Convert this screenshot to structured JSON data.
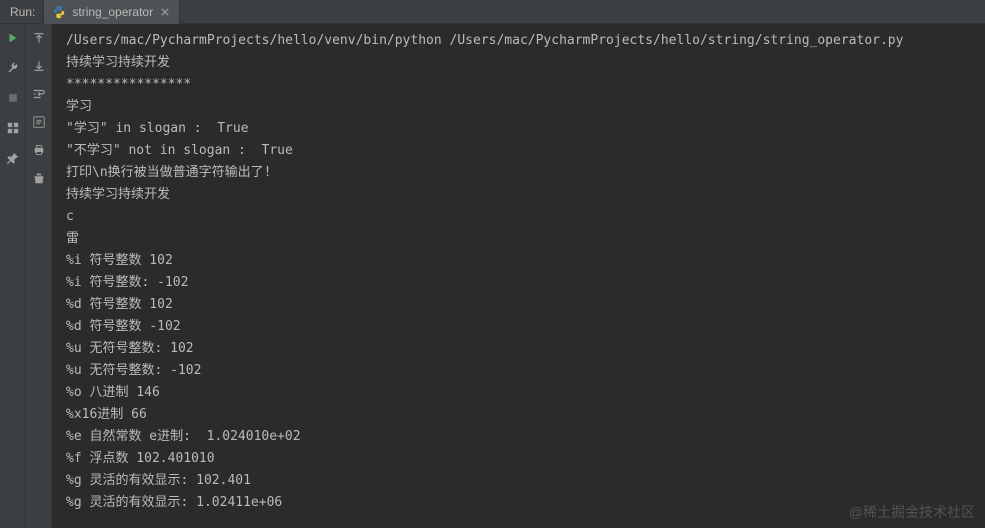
{
  "header": {
    "run_label": "Run:",
    "tab_name": "string_operator"
  },
  "console": {
    "lines": [
      "/Users/mac/PycharmProjects/hello/venv/bin/python /Users/mac/PycharmProjects/hello/string/string_operator.py",
      "持续学习持续开发",
      "****************",
      "学习",
      "\"学习\" in slogan :  True",
      "\"不学习\" not in slogan :  True",
      "打印\\n换行被当做普通字符输出了!",
      "持续学习持续开发",
      "c",
      "雷",
      "%i 符号整数 102",
      "%i 符号整数: -102",
      "%d 符号整数 102",
      "%d 符号整数 -102",
      "%u 无符号整数: 102",
      "%u 无符号整数: -102",
      "%o 八进制 146",
      "%x16进制 66",
      "%e 自然常数 e进制:  1.024010e+02",
      "%f 浮点数 102.401010",
      "%g 灵活的有效显示: 102.401",
      "%g 灵活的有效显示: 1.02411e+06"
    ]
  },
  "watermark": "@稀土掘金技术社区"
}
